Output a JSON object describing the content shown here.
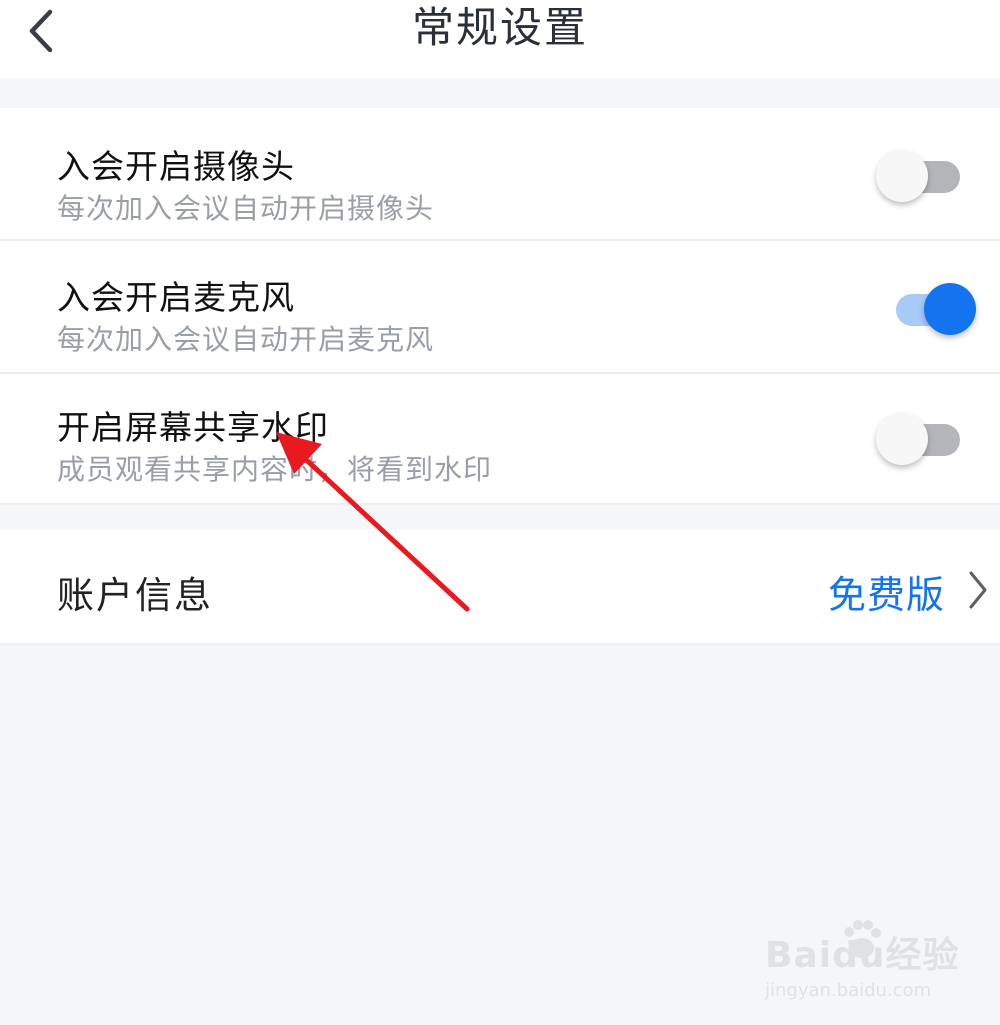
{
  "header": {
    "title": "常规设置",
    "back_icon": "back-chevron-icon"
  },
  "settings": [
    {
      "title": "入会开启摄像头",
      "desc": "每次加入会议自动开启摄像头",
      "enabled": false
    },
    {
      "title": "入会开启麦克风",
      "desc": "每次加入会议自动开启麦克风",
      "enabled": true
    },
    {
      "title": "开启屏幕共享水印",
      "desc": "成员观看共享内容时，将看到水印",
      "enabled": false
    }
  ],
  "account": {
    "label": "账户信息",
    "value": "免费版",
    "icon": "chevron-right-icon"
  },
  "colors": {
    "accent": "#1473ee",
    "toggle_on_track": "#a7caf8",
    "toggle_off_track": "#b3b5b9",
    "annotation_arrow": "#e8191f"
  },
  "watermark": {
    "text": "Baidu经验",
    "url": "jingyan.baidu.com"
  }
}
